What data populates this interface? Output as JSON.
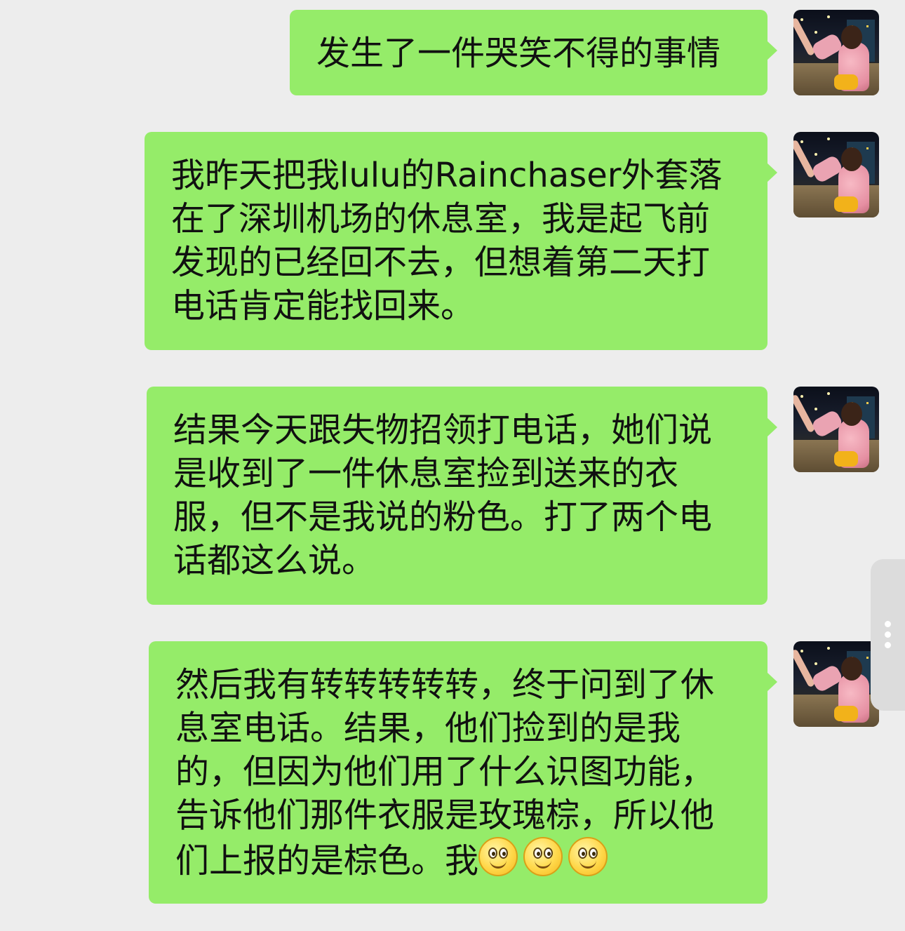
{
  "chat": {
    "messages": [
      {
        "sender": "me",
        "text": "发生了一件哭笑不得的事情"
      },
      {
        "sender": "me",
        "text": "我昨天把我lulu的Rainchaser外套落\n在了深圳机场的休息室，我是起飞前\n发现的已经回不去，但想着第二天打\n电话肯定能找回来。"
      },
      {
        "sender": "me",
        "text": "结果今天跟失物招领打电话，她们说\n是收到了一件休息室捡到送来的衣\n服，但不是我说的粉色。打了两个电\n话都这么说。"
      },
      {
        "sender": "me",
        "text": "然后我有转转转转转，终于问到了休\n息室电话。结果，他们捡到的是我\n的，但因为他们用了什么识图功能，\n告诉他们那件衣服是玫瑰棕，所以他\n们上报的是棕色。我",
        "emojis": [
          "smile-emoji",
          "smile-emoji",
          "smile-emoji"
        ]
      }
    ]
  },
  "colors": {
    "background": "#ededed",
    "bubble": "#95ec69",
    "text": "#111111"
  }
}
